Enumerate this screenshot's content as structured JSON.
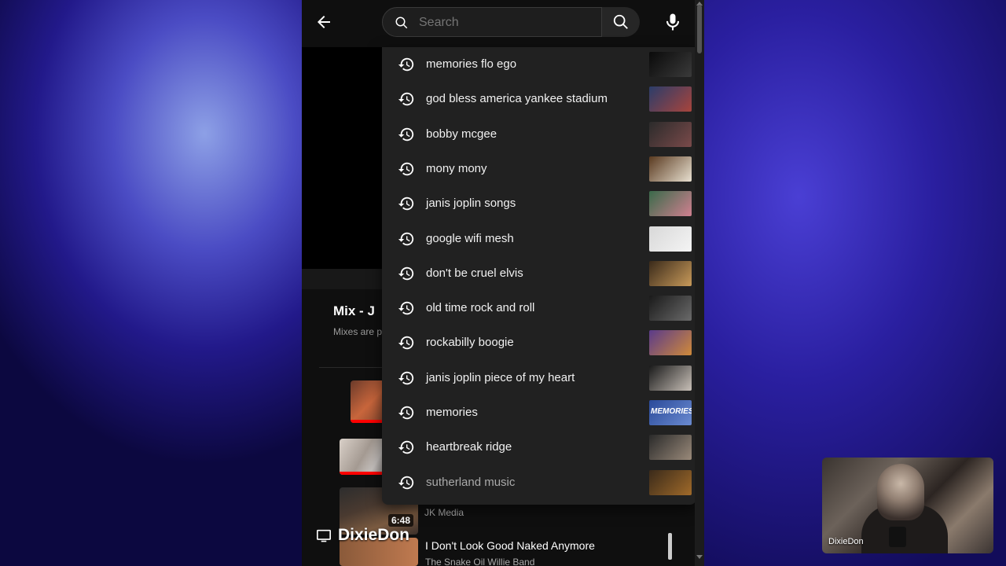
{
  "search": {
    "placeholder": "Search",
    "value": ""
  },
  "suggestions": [
    {
      "text": "memories flo ego",
      "thumb": [
        "#0a0a0a",
        "#3a3a3a"
      ]
    },
    {
      "text": "god bless america yankee stadium",
      "thumb": [
        "#2b3d6a",
        "#a8443c"
      ]
    },
    {
      "text": "bobby mcgee",
      "thumb": [
        "#2b2b2b",
        "#7a4a4a"
      ]
    },
    {
      "text": "mony mony",
      "thumb": [
        "#5a3a20",
        "#e8e0d0"
      ]
    },
    {
      "text": "janis joplin songs",
      "thumb": [
        "#3a6a4a",
        "#d08090"
      ]
    },
    {
      "text": "google wifi mesh",
      "thumb": [
        "#d8d8d8",
        "#f4f4f4"
      ]
    },
    {
      "text": "don't be cruel elvis",
      "thumb": [
        "#3a2a1a",
        "#c89a5a"
      ]
    },
    {
      "text": "old time rock and roll",
      "thumb": [
        "#1a1a1a",
        "#6a6a6a"
      ]
    },
    {
      "text": "rockabilly boogie",
      "thumb": [
        "#5a3a8a",
        "#d08a3a"
      ]
    },
    {
      "text": "janis joplin piece of my heart",
      "thumb": [
        "#1a1a1a",
        "#c8c0b8"
      ]
    },
    {
      "text": "memories",
      "thumb": [
        "#2a4a9a",
        "#6a8ad0"
      ],
      "overlay": "MEMORIES"
    },
    {
      "text": "heartbreak ridge",
      "thumb": [
        "#2a2a2a",
        "#9a8a7a"
      ]
    },
    {
      "text": "sutherland music",
      "thumb": [
        "#3a2a1a",
        "#a06a2a"
      ]
    }
  ],
  "mix": {
    "title": "Mix - J",
    "subtitle": "Mixes are p"
  },
  "video": {
    "duration": "6:48",
    "channel_top": "JK Media",
    "title": "I Don't Look Good Naked Anymore",
    "channel": "The Snake Oil Willie Band"
  },
  "cast": {
    "label": "DixieDon"
  },
  "webcam": {
    "name": "DixieDon"
  },
  "icons": {
    "back": "arrow-left-icon",
    "search": "search-icon",
    "mic": "microphone-icon",
    "history": "history-icon",
    "cast": "cast-icon"
  }
}
